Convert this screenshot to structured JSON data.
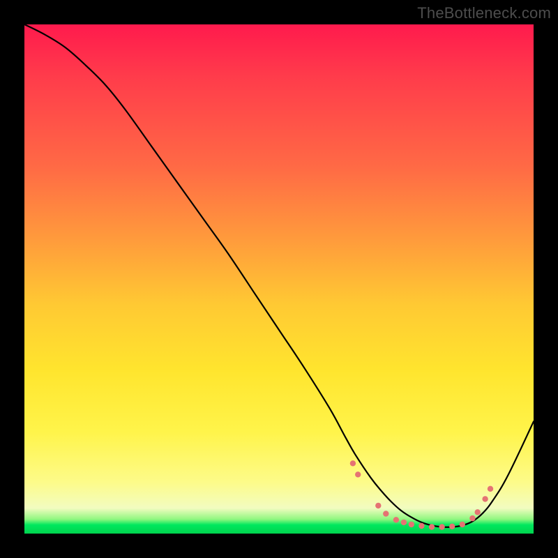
{
  "watermark": "TheBottleneck.com",
  "chart_data": {
    "type": "line",
    "title": "",
    "xlabel": "",
    "ylabel": "",
    "xlim": [
      0,
      100
    ],
    "ylim": [
      0,
      100
    ],
    "series": [
      {
        "name": "curve",
        "x": [
          0,
          4,
          8,
          12,
          16,
          20,
          25,
          30,
          35,
          40,
          45,
          50,
          55,
          60,
          63,
          65,
          68,
          70,
          72,
          74,
          76,
          78,
          80,
          82,
          84,
          86,
          88,
          90,
          92,
          95,
          100
        ],
        "y": [
          100,
          98,
          95.5,
          92,
          88,
          83,
          76,
          69,
          62,
          55,
          47.5,
          40,
          32.5,
          24.5,
          19,
          15.5,
          11,
          8.5,
          6.3,
          4.5,
          3.2,
          2.2,
          1.6,
          1.3,
          1.3,
          1.6,
          2.4,
          4.0,
          6.5,
          11.5,
          22
        ]
      }
    ],
    "markers": {
      "name": "optimal-range-dots",
      "color": "#e57373",
      "points": [
        {
          "x": 64.5,
          "y": 13.8
        },
        {
          "x": 65.5,
          "y": 11.6
        },
        {
          "x": 69.5,
          "y": 5.5
        },
        {
          "x": 71,
          "y": 3.9
        },
        {
          "x": 73,
          "y": 2.7
        },
        {
          "x": 74.5,
          "y": 2.2
        },
        {
          "x": 76,
          "y": 1.8
        },
        {
          "x": 78,
          "y": 1.5
        },
        {
          "x": 80,
          "y": 1.3
        },
        {
          "x": 82,
          "y": 1.3
        },
        {
          "x": 84,
          "y": 1.4
        },
        {
          "x": 86,
          "y": 1.8
        },
        {
          "x": 88,
          "y": 3.0
        },
        {
          "x": 89,
          "y": 4.2
        },
        {
          "x": 90.5,
          "y": 6.8
        },
        {
          "x": 91.5,
          "y": 8.8
        }
      ]
    }
  }
}
